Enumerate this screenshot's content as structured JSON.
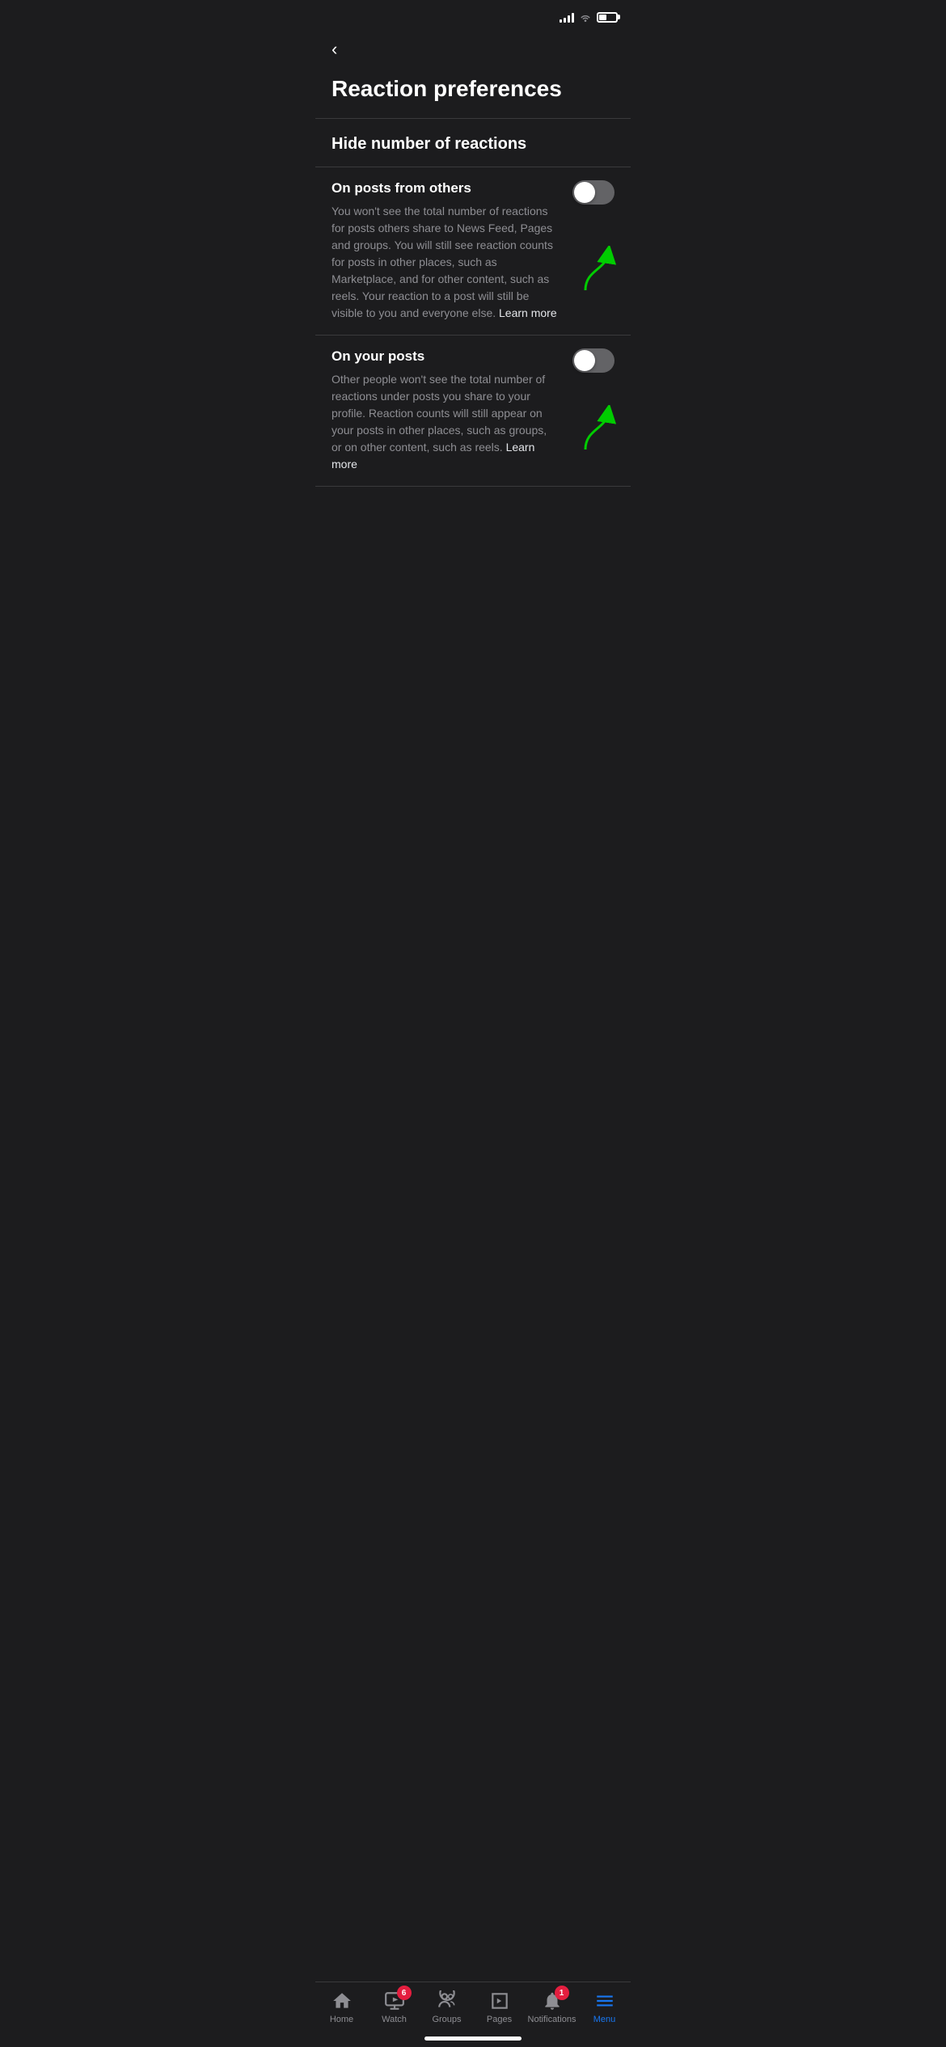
{
  "statusBar": {
    "signal": [
      4,
      6,
      8,
      10,
      12
    ],
    "battery": 45
  },
  "header": {
    "backLabel": "‹",
    "pageTitle": "Reaction preferences"
  },
  "sectionHeading": "Hide number of reactions",
  "settings": [
    {
      "id": "on-posts-from-others",
      "title": "On posts from others",
      "description": "You won't see the total number of reactions for posts others share to News Feed, Pages and groups. You will still see reaction counts for posts in other places, such as Marketplace, and for other content, such as reels. Your reaction to a post will still be visible to you and everyone else.",
      "learnMore": "Learn more",
      "enabled": false
    },
    {
      "id": "on-your-posts",
      "title": "On your posts",
      "description": "Other people won't see the total number of reactions under posts you share to your profile. Reaction counts will still appear on your posts in other places, such as groups, or on other content, such as reels.",
      "learnMore": "Learn more",
      "enabled": false
    }
  ],
  "bottomNav": {
    "items": [
      {
        "id": "home",
        "label": "Home",
        "icon": "home-icon",
        "badge": null,
        "active": false
      },
      {
        "id": "watch",
        "label": "Watch",
        "icon": "watch-icon",
        "badge": "6",
        "active": false
      },
      {
        "id": "groups",
        "label": "Groups",
        "icon": "groups-icon",
        "badge": null,
        "active": false
      },
      {
        "id": "pages",
        "label": "Pages",
        "icon": "pages-icon",
        "badge": null,
        "active": false
      },
      {
        "id": "notifications",
        "label": "Notifications",
        "icon": "bell-icon",
        "badge": "1",
        "active": false
      },
      {
        "id": "menu",
        "label": "Menu",
        "icon": "menu-icon",
        "badge": null,
        "active": true
      }
    ]
  }
}
